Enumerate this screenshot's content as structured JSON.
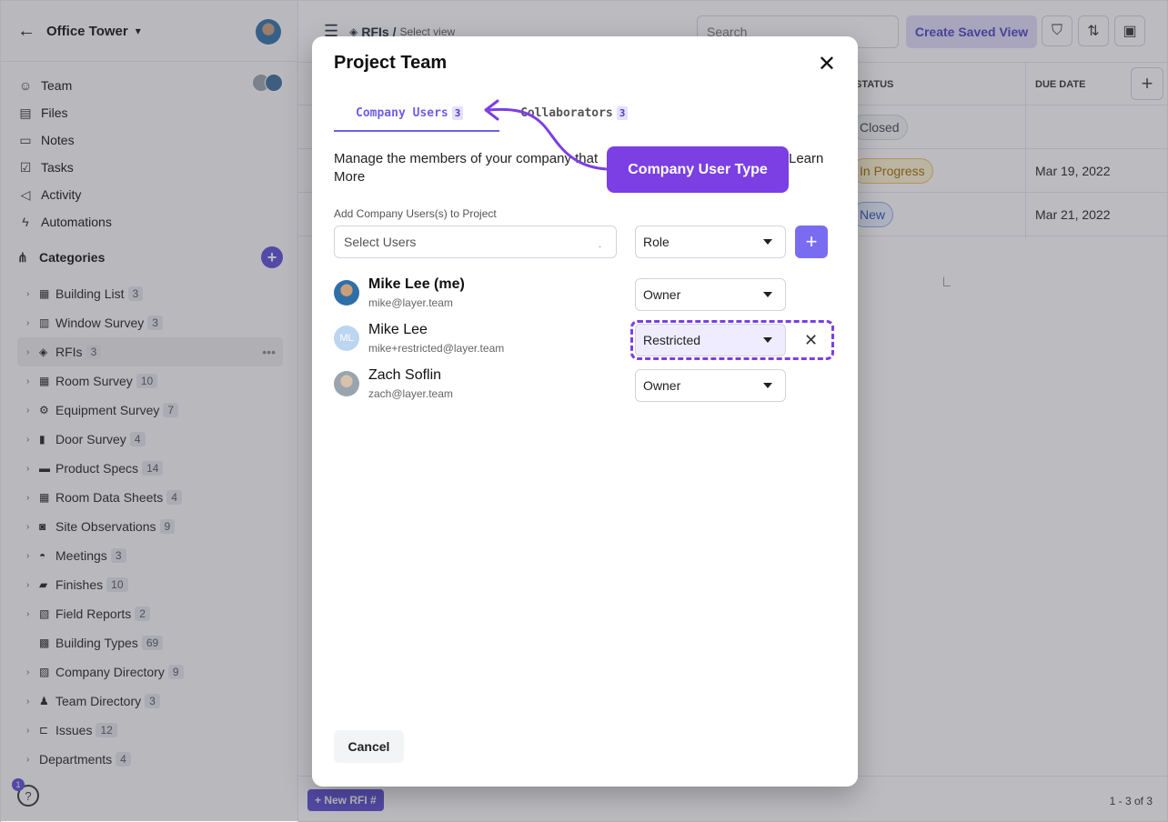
{
  "sidebar": {
    "project_name": "Office Tower",
    "nav": [
      {
        "label": "Team",
        "icon": "team-icon"
      },
      {
        "label": "Files",
        "icon": "files-icon"
      },
      {
        "label": "Notes",
        "icon": "notes-icon"
      },
      {
        "label": "Tasks",
        "icon": "tasks-icon"
      },
      {
        "label": "Activity",
        "icon": "activity-icon"
      },
      {
        "label": "Automations",
        "icon": "automations-icon"
      }
    ],
    "categories_label": "Categories",
    "categories": [
      {
        "label": "Building List",
        "count": "3"
      },
      {
        "label": "Window Survey",
        "count": "3"
      },
      {
        "label": "RFIs",
        "count": "3"
      },
      {
        "label": "Room Survey",
        "count": "10"
      },
      {
        "label": "Equipment Survey",
        "count": "7"
      },
      {
        "label": "Door Survey",
        "count": "4"
      },
      {
        "label": "Product Specs",
        "count": "14"
      },
      {
        "label": "Room Data Sheets",
        "count": "4"
      },
      {
        "label": "Site Observations",
        "count": "9"
      },
      {
        "label": "Meetings",
        "count": "3"
      },
      {
        "label": "Finishes",
        "count": "10"
      },
      {
        "label": "Field Reports",
        "count": "2"
      },
      {
        "label": "Building Types",
        "count": "69"
      },
      {
        "label": "Company Directory",
        "count": "9"
      },
      {
        "label": "Team Directory",
        "count": "3"
      },
      {
        "label": "Issues",
        "count": "12"
      },
      {
        "label": "Departments",
        "count": "4"
      }
    ],
    "help_badge": "1",
    "help_label": "?"
  },
  "toolbar": {
    "breadcrumb_title": "RFIs /",
    "select_view": "Select view",
    "search_placeholder": "Search",
    "saved_view_label": "Create Saved View"
  },
  "table": {
    "headers": {
      "status": "STATUS",
      "due_date": "DUE DATE"
    },
    "rows": [
      {
        "status": "Closed",
        "due": ""
      },
      {
        "status": "In Progress",
        "due": "Mar 19, 2022"
      },
      {
        "status": "New",
        "due": "Mar 21, 2022"
      }
    ]
  },
  "footer": {
    "new_rfi_label": "New RFI #",
    "pager": "1 - 3 of 3"
  },
  "modal": {
    "title": "Project Team",
    "tabs": [
      {
        "label": "Company Users",
        "count": "3"
      },
      {
        "label": "Collaborators",
        "count": "3"
      }
    ],
    "description": "Manage the members of your company that",
    "learn": "Learn",
    "more": "More",
    "add_label": "Add Company Users(s) to Project",
    "select_users_placeholder": "Select Users",
    "role_placeholder": "Role",
    "members": [
      {
        "name": "Mike Lee (me)",
        "email": "mike@layer.team",
        "role": "Owner"
      },
      {
        "name": "Mike Lee",
        "email": "mike+restricted@layer.team",
        "role": "Restricted",
        "initials": "ML"
      },
      {
        "name": "Zach Soflin",
        "email": "zach@layer.team",
        "role": "Owner"
      }
    ],
    "cancel_label": "Cancel"
  },
  "annotation": {
    "callout_text": "Company User Type"
  },
  "colors": {
    "accent": "#6d5ee8",
    "callout": "#7b3fe4",
    "overlay": "rgba(70,70,80,0.36)"
  }
}
